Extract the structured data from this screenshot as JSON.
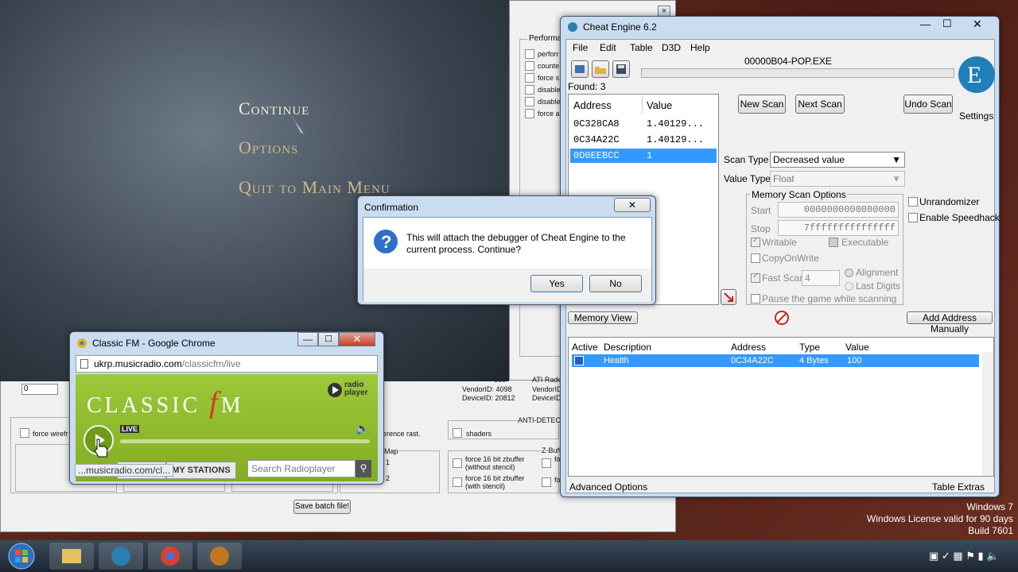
{
  "game": {
    "menu": [
      "Continue",
      "Options",
      "Quit to Main Menu"
    ]
  },
  "bg_window": {
    "group_title": "Performa",
    "checks": [
      "perforr",
      "counte",
      "force s",
      "disable",
      "disable",
      "force a"
    ],
    "field_value": "0",
    "gpu_lines": [
      "ATI Rade",
      "VendorID: 4098",
      "VendorID:",
      "DeviceID: 20812",
      "DeviceID"
    ],
    "gpu_num": "000",
    "anti_label": "ANTI-DETEC",
    "opts": [
      "force wirefr",
      "erence rast.",
      "shaders"
    ],
    "map_label": "Map",
    "map_vals": [
      "1",
      "2"
    ],
    "zbuf_label": "Z-Buff",
    "zbuf_opts": [
      "force 16 bit zbuffer (without stencil)",
      "force 16 bit zbuffer (with stencil)"
    ],
    "zbuf_short": [
      "fo",
      "fo"
    ],
    "save_button": "Save batch file!"
  },
  "cheat_engine": {
    "title": "Cheat Engine 6.2",
    "menu": [
      "File",
      "Edit",
      "Table",
      "D3D",
      "Help"
    ],
    "process": "00000B04-POP.EXE",
    "found": "Found: 3",
    "columns": {
      "address": "Address",
      "value": "Value"
    },
    "results": [
      {
        "address": "0C328CA8",
        "value": "1.40129..."
      },
      {
        "address": "0C34A22C",
        "value": "1.40129..."
      },
      {
        "address": "0D0EEBCC",
        "value": "1"
      }
    ],
    "new_scan": "New Scan",
    "next_scan": "Next Scan",
    "undo_scan": "Undo Scan",
    "settings": "Settings",
    "scan_type_label": "Scan Type",
    "scan_type": "Decreased value",
    "value_type_label": "Value Type",
    "value_type": "Float",
    "mem_opts": "Memory Scan Options",
    "start_label": "Start",
    "start": "0000000000000000",
    "stop_label": "Stop",
    "stop": "7fffffffffffffff",
    "writable": "Writable",
    "executable": "Executable",
    "copyonwrite": "CopyOnWrite",
    "fast_scan": "Fast Scan",
    "fast_val": "4",
    "alignment": "Alignment",
    "last_digits": "Last Digits",
    "pause": "Pause the game while scanning",
    "unrandomizer": "Unrandomizer",
    "speedhack": "Enable Speedhack",
    "memory_view": "Memory View",
    "add_manual": "Add Address Manually",
    "table_cols": [
      "Active",
      "Description",
      "Address",
      "Type",
      "Value"
    ],
    "table_rows": [
      {
        "description": "Health",
        "address": "0C34A22C",
        "type": "4 Bytes",
        "value": "100"
      }
    ],
    "advanced": "Advanced Options",
    "table_extras": "Table Extras"
  },
  "dialog": {
    "title": "Confirmation",
    "message": "This will attach the debugger of Cheat Engine to the current process. Continue?",
    "yes": "Yes",
    "no": "No",
    "close": "✕"
  },
  "chrome": {
    "title": "Classic FM - Google Chrome",
    "url_domain": "ukrp.musicradio.com",
    "url_path": "/classicfm/live",
    "logo_left": "CLASSIC",
    "logo_mid": "f",
    "logo_right": "M",
    "radioplayer_1": "radio",
    "radioplayer_2": "player",
    "live": "LIVE",
    "my_stations": "MY STATIONS",
    "search_placeholder": "Search Radioplayer",
    "status_url": "...musicradio.com/cl..."
  },
  "watermark": {
    "line1": "Windows 7",
    "line2": "Windows License valid for 90 days",
    "line3": "Build 7601"
  },
  "colors": {
    "selection": "#3399ff",
    "classicfm_green": "#8fb82a",
    "logo_red": "#e0322a"
  }
}
